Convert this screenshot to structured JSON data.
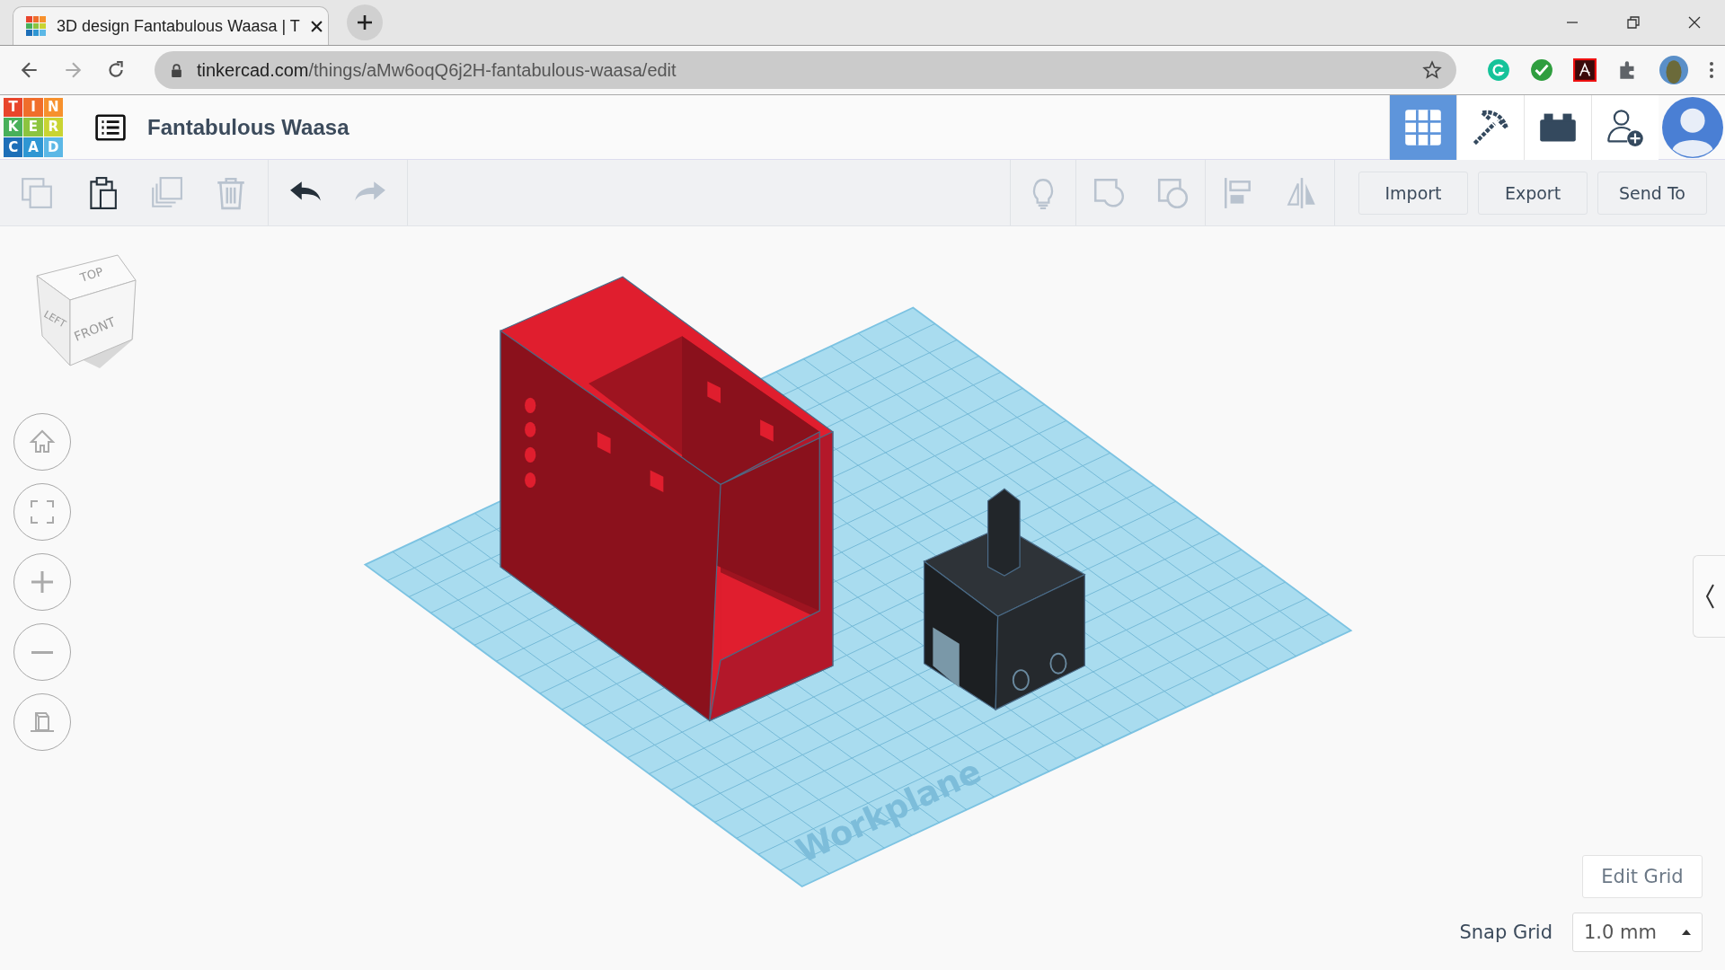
{
  "browser": {
    "tab_title": "3D design Fantabulous Waasa | T",
    "url_host": "tinkercad.com",
    "url_path": "/things/aMw6oqQ6j2H-fantabulous-waasa/edit"
  },
  "app": {
    "logo": [
      {
        "letter": "T",
        "color": "#e8452c"
      },
      {
        "letter": "I",
        "color": "#f06d2b"
      },
      {
        "letter": "N",
        "color": "#f7912d"
      },
      {
        "letter": "K",
        "color": "#48b05a"
      },
      {
        "letter": "E",
        "color": "#8cc43f"
      },
      {
        "letter": "R",
        "color": "#c9d432"
      },
      {
        "letter": "C",
        "color": "#1d6fb8"
      },
      {
        "letter": "A",
        "color": "#2e96d3"
      },
      {
        "letter": "D",
        "color": "#5cb8e6"
      }
    ],
    "design_name": "Fantabulous Waasa",
    "view_buttons": [
      {
        "kind": "grid",
        "selected": true
      },
      {
        "kind": "pickaxe",
        "selected": false
      },
      {
        "kind": "bricks",
        "selected": false
      }
    ]
  },
  "toolbar": {
    "edit_actions": [
      {
        "kind": "copy",
        "disabled": true
      },
      {
        "kind": "paste",
        "disabled": false
      },
      {
        "kind": "duplicate",
        "disabled": true
      },
      {
        "kind": "delete",
        "disabled": true
      }
    ],
    "history_actions": [
      {
        "kind": "undo",
        "disabled": false
      },
      {
        "kind": "redo",
        "disabled": true
      }
    ],
    "shape_actions": [
      {
        "kind": "note",
        "disabled": true
      },
      {
        "kind": "group",
        "disabled": true
      },
      {
        "kind": "ungroup",
        "disabled": true
      },
      {
        "kind": "align",
        "disabled": true
      },
      {
        "kind": "mirror",
        "disabled": true
      }
    ],
    "buttons": [
      "Import",
      "Export",
      "Send To"
    ]
  },
  "view_cube": {
    "top": "TOP",
    "left": "LEFT",
    "front": "FRONT"
  },
  "view_controls": [
    {
      "kind": "home"
    },
    {
      "kind": "fit"
    },
    {
      "kind": "zoom-in"
    },
    {
      "kind": "zoom-out"
    },
    {
      "kind": "perspective"
    }
  ],
  "workplane": {
    "label": "Workplane"
  },
  "grid": {
    "edit_button": "Edit Grid",
    "snap_label": "Snap Grid",
    "snap_value": "1.0 mm"
  }
}
